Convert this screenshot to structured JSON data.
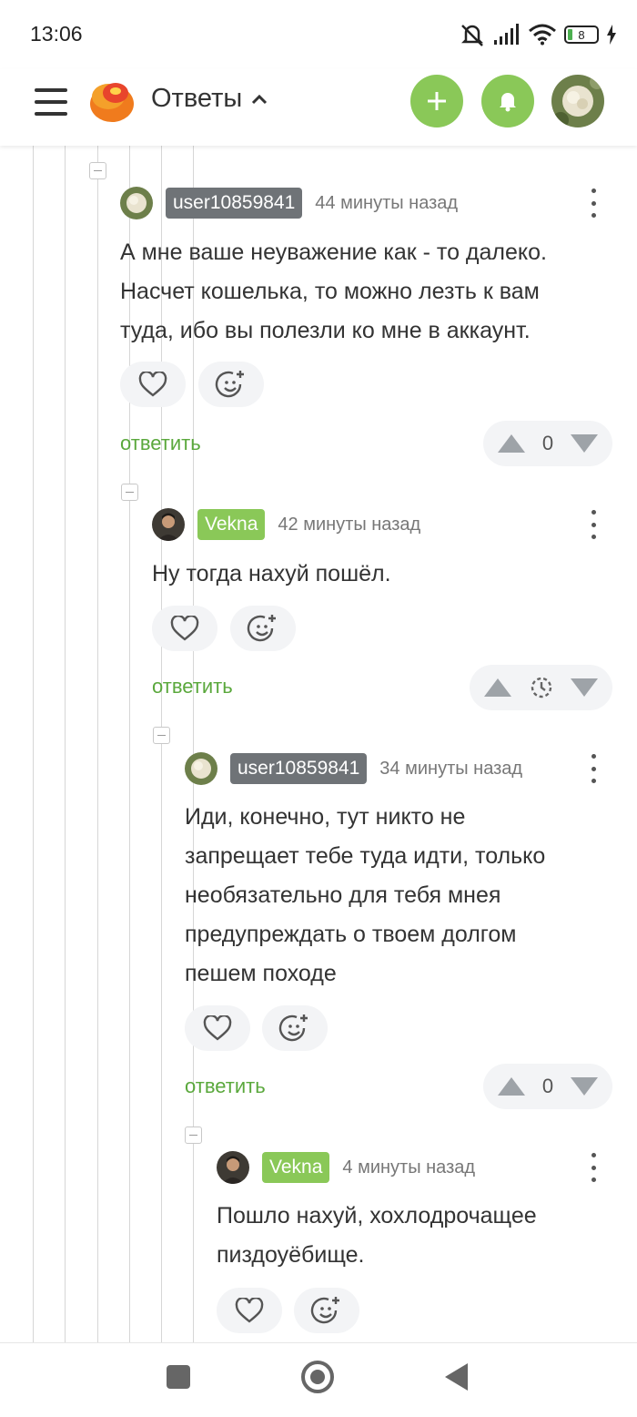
{
  "status": {
    "time": "13:06",
    "battery": "8"
  },
  "header": {
    "title": "Ответы"
  },
  "comments": [
    {
      "user": "user10859841",
      "time": "44 минуты назад",
      "lines": [
        "А мне ваше неуважение как - то далеко.",
        "Насчет кошелька, то можно лезть к вам",
        "туда, ибо вы полезли ко мне в аккаунт."
      ],
      "reply": "ответить",
      "score": "0"
    },
    {
      "user": "Vekna",
      "time": "42 минуты назад",
      "lines": [
        "Ну тогда нахуй пошёл."
      ],
      "reply": "ответить",
      "score": ""
    },
    {
      "user": "user10859841",
      "time": "34 минуты назад",
      "lines": [
        "Иди, конечно, тут никто не",
        "запрещает тебе туда идти, только",
        "необязательно для тебя мнея",
        "предупреждать о твоем долгом",
        "пешем походе"
      ],
      "reply": "ответить",
      "score": "0"
    },
    {
      "user": "Vekna",
      "time": "4 минуты назад",
      "lines": [
        "Пошло нахуй, хохлодрочащее",
        "пиздоуёбище."
      ]
    }
  ],
  "colors": {
    "accent_green": "#8ac858",
    "reply_green": "#5aa83c",
    "badge_gray": "#6f7377"
  },
  "icons": [
    "menu-icon",
    "logo-icon",
    "chevron-up-icon",
    "plus-icon",
    "bell-icon",
    "heart-icon",
    "emoji-add-icon",
    "kebab-icon",
    "vote-up-icon",
    "vote-down-icon",
    "timer-icon"
  ]
}
